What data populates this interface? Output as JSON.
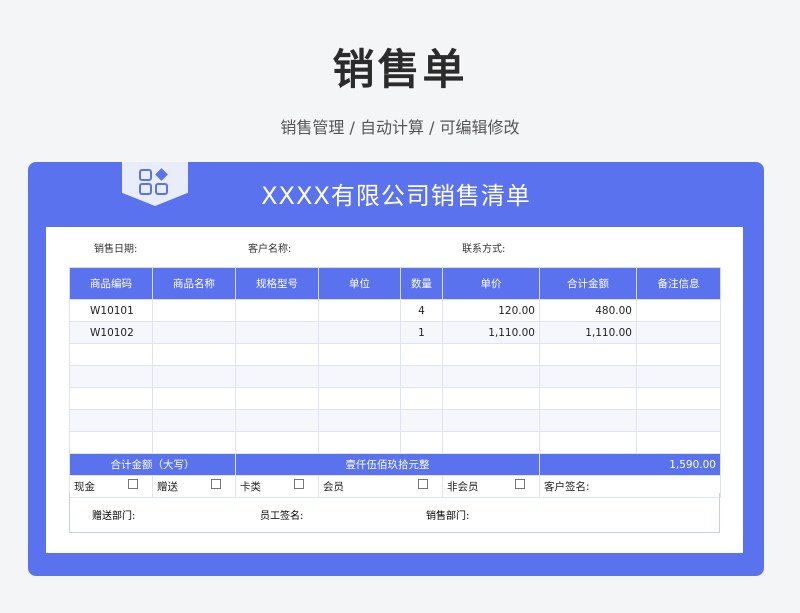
{
  "header": {
    "title": "销售单",
    "subtitle": "销售管理 / 自动计算 /  可编辑修改"
  },
  "card": {
    "title": "XXXX有限公司销售清单",
    "badge_icon": "grid-apps-icon"
  },
  "info": {
    "date_label": "销售日期:",
    "customer_label": "客户名称:",
    "contact_label": "联系方式:"
  },
  "table": {
    "columns": [
      "商品编码",
      "商品名称",
      "规格型号",
      "单位",
      "数量",
      "单价",
      "合计金额",
      "备注信息"
    ],
    "rows": [
      [
        "W10101",
        "",
        "",
        "",
        "4",
        "120.00",
        "480.00",
        ""
      ],
      [
        "W10102",
        "",
        "",
        "",
        "1",
        "1,110.00",
        "1,110.00",
        ""
      ],
      [
        "",
        "",
        "",
        "",
        "",
        "",
        "",
        ""
      ],
      [
        "",
        "",
        "",
        "",
        "",
        "",
        "",
        ""
      ],
      [
        "",
        "",
        "",
        "",
        "",
        "",
        "",
        ""
      ],
      [
        "",
        "",
        "",
        "",
        "",
        "",
        "",
        ""
      ],
      [
        "",
        "",
        "",
        "",
        "",
        "",
        "",
        ""
      ]
    ]
  },
  "total": {
    "label": "合计金额（大写）",
    "words": "壹仟伍佰玖拾元整",
    "amount": "1,590.00"
  },
  "options": {
    "cash": "现金",
    "gift": "赠送",
    "card": "卡类",
    "member": "会员",
    "nonmember": "非会员",
    "customer_sign": "客户签名:"
  },
  "footer": {
    "gift_dept": "赠送部门:",
    "staff_sign": "员工签名:",
    "sales_dept": "销售部门:"
  },
  "colors": {
    "accent": "#5a72ee"
  }
}
